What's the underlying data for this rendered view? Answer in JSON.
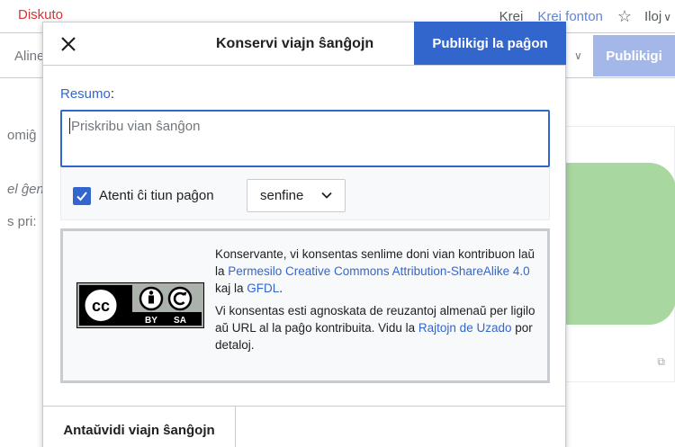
{
  "background": {
    "tab_discuss": "Diskuto",
    "tab_create": "Krei",
    "tab_create_source": "Krei fonton",
    "tools_label": "Iloj",
    "align_label": "Aline",
    "publish_label": "Publikigi",
    "text_line1": "omiĝ",
    "text_line2": "el ĝen",
    "text_line3": "s pri:"
  },
  "dialog": {
    "title": "Konservi viajn ŝanĝojn",
    "publish_label": "Publikigi la paĝon",
    "summary_label": "Resumo",
    "summary_colon": ":",
    "summary_placeholder": "Priskribu vian ŝanĝon",
    "watch_label": "Atenti ĉi tiun paĝon",
    "watch_checked": true,
    "watch_period": "senfine",
    "license": {
      "p1_before": "Konservante, vi konsentas senlime doni vian kontribuon laŭ la ",
      "p1_link1": "Permesilo Creative Commons Attribution-ShareAlike 4.0",
      "p1_middle": " kaj la ",
      "p1_link2": "GFDL",
      "p1_after": ".",
      "p2_before": "Vi konsentas esti agnoskata de reuzantoj almenaŭ per ligilo aŭ URL al la paĝo kontribuita. Vidu la ",
      "p2_link": "Rajtojn de Uzado",
      "p2_after": " por detaloj."
    },
    "badge": {
      "cc": "cc",
      "by": "BY",
      "sa": "SA"
    },
    "preview_label": "Antaŭvidi viajn ŝanĝojn"
  },
  "colors": {
    "accent": "#3366cc",
    "background_publish": "#a3b8e8",
    "discuss_tab": "#d73333",
    "illustration_green": "#a9d7a0"
  }
}
